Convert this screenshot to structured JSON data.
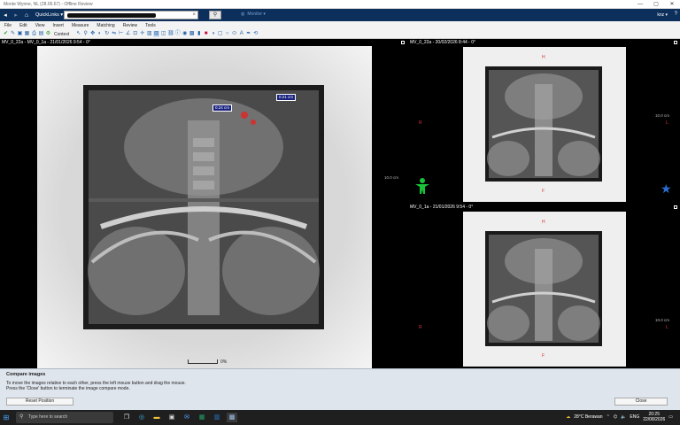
{
  "window": {
    "title": "Monte Wynne, NL (28.06.67) - Offline Review",
    "controls": [
      "—",
      "▢",
      "✕"
    ]
  },
  "nav": {
    "quicklinks_label": "QuickLinks ▾",
    "monitor_label": "Monitor ▾",
    "user": "knz ▾",
    "search_placeholder": ""
  },
  "menu": [
    "File",
    "Edit",
    "View",
    "Insert",
    "Measure",
    "Matching",
    "Review",
    "Tools"
  ],
  "toolbar": {
    "context_label": "Context"
  },
  "viewports": {
    "main": {
      "title": "MV_0_22a - MV_0_1a - 21/01/2026 9:54 - 0°",
      "scale": "10.0 cm",
      "zoom": "0%",
      "measure1": "0.24 cm",
      "measure2": "0.21 cm"
    },
    "top_right": {
      "title": "MV_0_22a - 20/02/2026 8:44 - 0°",
      "head": "H",
      "foot": "F",
      "right": "R",
      "left": "L",
      "scale": "10.0 cm"
    },
    "bottom_right": {
      "title": "MV_0_1a - 21/01/2026 9:54 - 0°",
      "head": "H",
      "foot": "F",
      "right": "R",
      "left": "L",
      "scale": "10.0 cm"
    }
  },
  "compare": {
    "title": "Compare images",
    "line1": "To move the images relative to each other, press the left mouse button and drag the mouse.",
    "line2": "Press the 'Close' button to terminate the image compare mode.",
    "reset": "Reset Position",
    "close": "Close"
  },
  "taskbar": {
    "search": "Type here to search",
    "weather": "28°C  Berawan",
    "time": "20:25",
    "date": "22/08/2026"
  },
  "colors": {
    "nav": "#0c2f5c",
    "measure": "#1a237e",
    "orient": "#d33333",
    "figure": "#19c23a",
    "star": "#2a6fd0"
  }
}
